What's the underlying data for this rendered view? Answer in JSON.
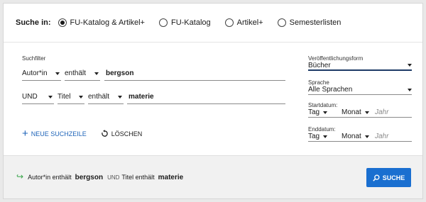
{
  "scope": {
    "label": "Suche in:",
    "options": [
      {
        "label": "FU-Katalog & Artikel+",
        "selected": true
      },
      {
        "label": "FU-Katalog",
        "selected": false
      },
      {
        "label": "Artikel+",
        "selected": false
      },
      {
        "label": "Semesterlisten",
        "selected": false
      }
    ]
  },
  "filters": {
    "title": "Suchfilter",
    "row1": {
      "field": "Autor*in",
      "operator": "enthält",
      "value": "bergson"
    },
    "row2": {
      "bool": "UND",
      "field": "Titel",
      "operator": "enthält",
      "value": "materie"
    }
  },
  "actions": {
    "add": "NEUE SUCHZEILE",
    "reset": "LÖSCHEN"
  },
  "right_panel": {
    "publication": {
      "label": "Veröffentlichungsform",
      "value": "Bücher"
    },
    "language": {
      "label": "Sprache",
      "value": "Alle Sprachen"
    },
    "start_date": {
      "label": "Startdatum:",
      "day": "Tag",
      "month": "Monat",
      "year_placeholder": "Jahr"
    },
    "end_date": {
      "label": "Enddatum:",
      "day": "Tag",
      "month": "Monat",
      "year_placeholder": "Jahr"
    }
  },
  "summary": {
    "part1_field": "Autor*in enthält",
    "part1_value": "bergson",
    "bool": "UND",
    "part2_field": "Titel enthält",
    "part2_value": "materie"
  },
  "search_button": "SUCHE",
  "colors": {
    "accent": "#1a6fd0",
    "summary_arrow": "#3aa54a",
    "link": "#1d63b8"
  }
}
